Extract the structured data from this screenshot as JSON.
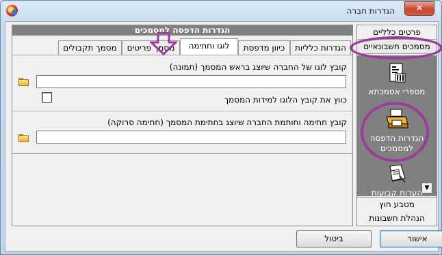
{
  "window": {
    "title": "הגדרות חברה",
    "close_label": "✕"
  },
  "nav": {
    "items_top": [
      "פרטים כלליים",
      "מסמכים חשבונאיים"
    ],
    "tiles": [
      "מספרי אסמכתא",
      "הגדרות הדפסה למסמכים",
      "הערות קבועות"
    ],
    "items_bottom": [
      "מטבע חוץ",
      "הנהלת חשבונות"
    ],
    "scroll_down": "▼"
  },
  "main": {
    "section_title": "הגדרות הדפסה למסמכים",
    "tabs": [
      "הגדרות כלליות",
      "כיוון מדפסת",
      "לוגו וחתימה",
      "מסמך פריטים",
      "מסמך תקבולים"
    ],
    "active_tab": 2,
    "logo_label": "קובץ לוגו של החברה שיוצג בראש המסמך (תמונה)",
    "logo_value": "",
    "fit_checkbox_label": "כווץ את קובץ הלוגו למידות המסמך",
    "fit_checked": false,
    "signature_label": "קובץ חתימה וחותמת החברה שיוצג בחתימת המסמך (חתימה סרוקה)",
    "signature_value": ""
  },
  "buttons": {
    "ok": "אישור",
    "cancel": "ביטול"
  },
  "colors": {
    "annotation": "#9b3b9b",
    "panel_gray": "#808080"
  }
}
